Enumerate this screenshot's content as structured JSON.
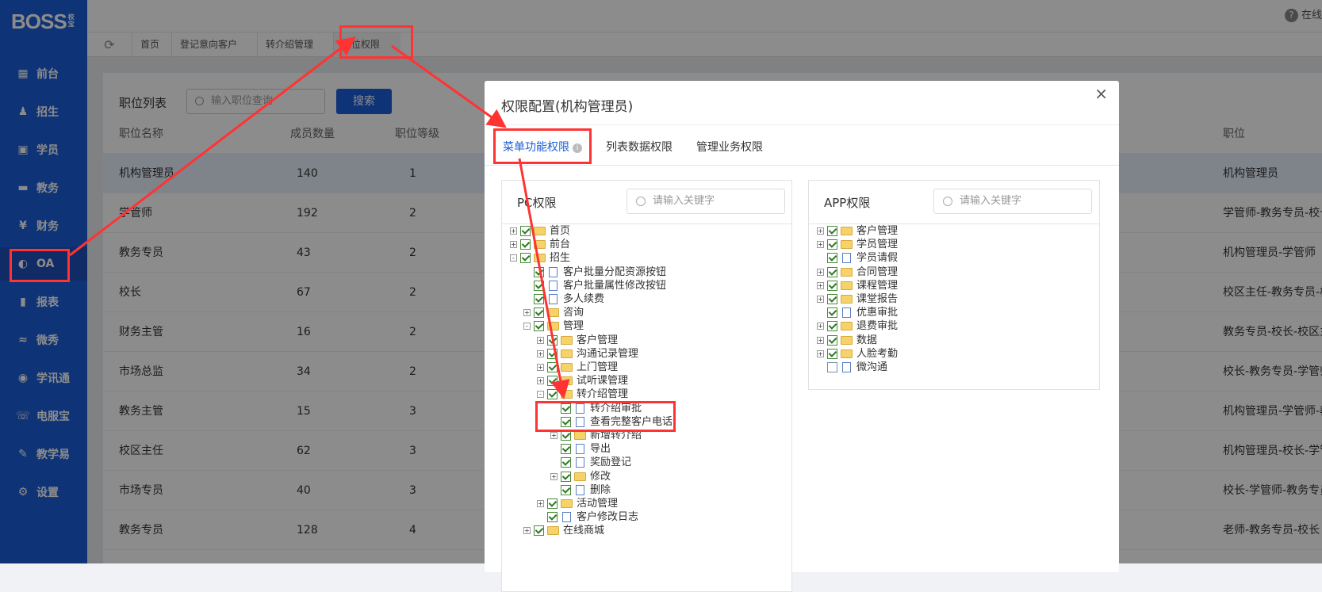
{
  "logo": {
    "text": "BOSS",
    "sub": "校宝"
  },
  "help": {
    "text": "在线"
  },
  "sidebar": {
    "items": [
      {
        "label": "前台",
        "icon": "calendar-icon"
      },
      {
        "label": "招生",
        "icon": "person-add-icon"
      },
      {
        "label": "学员",
        "icon": "student-card-icon"
      },
      {
        "label": "教务",
        "icon": "book-icon"
      },
      {
        "label": "财务",
        "icon": "yen-icon"
      },
      {
        "label": "OA",
        "icon": "chat-bubbles-icon"
      },
      {
        "label": "报表",
        "icon": "bar-chart-icon"
      },
      {
        "label": "微秀",
        "icon": "wave-icon"
      },
      {
        "label": "学讯通",
        "icon": "location-pin-icon"
      },
      {
        "label": "电服宝",
        "icon": "phone-icon"
      },
      {
        "label": "教学易",
        "icon": "pen-icon"
      },
      {
        "label": "设置",
        "icon": "gear-icon"
      }
    ],
    "active": "OA"
  },
  "tabs": [
    "首页",
    "登记意向客户",
    "转介绍管理",
    "职位权限"
  ],
  "list": {
    "title": "职位列表",
    "search_placeholder": "输入职位查询",
    "search_button": "搜索",
    "headers": [
      "职位名称",
      "成员数量",
      "职位等级",
      "职位"
    ],
    "rows": [
      [
        "机构管理员",
        "140",
        "1",
        "机构管理员"
      ],
      [
        "学管师",
        "192",
        "2",
        "学管师-教务专员-校长"
      ],
      [
        "教务专员",
        "43",
        "2",
        "机构管理员-学管师"
      ],
      [
        "校长",
        "67",
        "2",
        "校区主任-教务专员-校长"
      ],
      [
        "财务主管",
        "16",
        "2",
        "教务专员-校长-校区主任"
      ],
      [
        "市场总监",
        "34",
        "2",
        "校长-教务专员-学管师"
      ],
      [
        "教务主管",
        "15",
        "3",
        "机构管理员-学管师-教务"
      ],
      [
        "校区主任",
        "62",
        "3",
        "机构管理员-校长-学管师"
      ],
      [
        "市场专员",
        "40",
        "3",
        "校长-学管师-教务专员"
      ],
      [
        "教务专员",
        "128",
        "4",
        "老师-教务专员-校长"
      ]
    ]
  },
  "modal": {
    "title": "权限配置(机构管理员)",
    "close": "×",
    "tabs": [
      "菜单功能权限",
      "列表数据权限",
      "管理业务权限"
    ],
    "pc": {
      "title": "PC权限",
      "search_placeholder": "请输入关键字",
      "tree": [
        {
          "label": "首页",
          "depth": 0,
          "exp": "+",
          "type": "folder",
          "checked": true
        },
        {
          "label": "前台",
          "depth": 0,
          "exp": "+",
          "type": "folder",
          "checked": true
        },
        {
          "label": "招生",
          "depth": 0,
          "exp": "-",
          "type": "folder",
          "checked": true
        },
        {
          "label": "客户批量分配资源按钮",
          "depth": 1,
          "exp": "",
          "type": "doc",
          "checked": true
        },
        {
          "label": "客户批量属性修改按钮",
          "depth": 1,
          "exp": "",
          "type": "doc",
          "checked": true
        },
        {
          "label": "多人续费",
          "depth": 1,
          "exp": "",
          "type": "doc",
          "checked": true
        },
        {
          "label": "咨询",
          "depth": 1,
          "exp": "+",
          "type": "folder",
          "checked": true
        },
        {
          "label": "管理",
          "depth": 1,
          "exp": "-",
          "type": "folder",
          "checked": true
        },
        {
          "label": "客户管理",
          "depth": 2,
          "exp": "+",
          "type": "folder",
          "checked": true
        },
        {
          "label": "沟通记录管理",
          "depth": 2,
          "exp": "+",
          "type": "folder",
          "checked": true
        },
        {
          "label": "上门管理",
          "depth": 2,
          "exp": "+",
          "type": "folder",
          "checked": true
        },
        {
          "label": "试听课管理",
          "depth": 2,
          "exp": "+",
          "type": "folder",
          "checked": true
        },
        {
          "label": "转介绍管理",
          "depth": 2,
          "exp": "-",
          "type": "folder",
          "checked": true
        },
        {
          "label": "转介绍审批",
          "depth": 3,
          "exp": "",
          "type": "doc",
          "checked": true
        },
        {
          "label": "查看完整客户电话",
          "depth": 3,
          "exp": "",
          "type": "doc",
          "checked": true
        },
        {
          "label": "新增转介绍",
          "depth": 3,
          "exp": "+",
          "type": "folder",
          "checked": true
        },
        {
          "label": "导出",
          "depth": 3,
          "exp": "",
          "type": "doc",
          "checked": true
        },
        {
          "label": "奖励登记",
          "depth": 3,
          "exp": "",
          "type": "doc",
          "checked": true
        },
        {
          "label": "修改",
          "depth": 3,
          "exp": "+",
          "type": "folder",
          "checked": true
        },
        {
          "label": "删除",
          "depth": 3,
          "exp": "",
          "type": "doc",
          "checked": true
        },
        {
          "label": "活动管理",
          "depth": 2,
          "exp": "+",
          "type": "folder",
          "checked": true
        },
        {
          "label": "客户修改日志",
          "depth": 2,
          "exp": "",
          "type": "doc",
          "checked": true
        },
        {
          "label": "在线商城",
          "depth": 1,
          "exp": "+",
          "type": "folder",
          "checked": true
        }
      ]
    },
    "app": {
      "title": "APP权限",
      "search_placeholder": "请输入关键字",
      "tree": [
        {
          "label": "客户管理",
          "depth": 0,
          "exp": "+",
          "type": "folder",
          "checked": true
        },
        {
          "label": "学员管理",
          "depth": 0,
          "exp": "+",
          "type": "folder",
          "checked": true
        },
        {
          "label": "学员请假",
          "depth": 0,
          "exp": "",
          "type": "doc",
          "checked": true
        },
        {
          "label": "合同管理",
          "depth": 0,
          "exp": "+",
          "type": "folder",
          "checked": true
        },
        {
          "label": "课程管理",
          "depth": 0,
          "exp": "+",
          "type": "folder",
          "checked": true
        },
        {
          "label": "课堂报告",
          "depth": 0,
          "exp": "+",
          "type": "folder",
          "checked": true
        },
        {
          "label": "优惠审批",
          "depth": 0,
          "exp": "",
          "type": "doc",
          "checked": true
        },
        {
          "label": "退费审批",
          "depth": 0,
          "exp": "+",
          "type": "folder",
          "checked": true
        },
        {
          "label": "数据",
          "depth": 0,
          "exp": "+",
          "type": "folder",
          "checked": true
        },
        {
          "label": "人脸考勤",
          "depth": 0,
          "exp": "+",
          "type": "folder",
          "checked": true
        },
        {
          "label": "微沟通",
          "depth": 0,
          "exp": "",
          "type": "doc",
          "checked": false
        }
      ]
    }
  },
  "colors": {
    "sidebar": "#1a5ed8",
    "accent": "#1a5ed8",
    "annotation": "#ff3333"
  }
}
